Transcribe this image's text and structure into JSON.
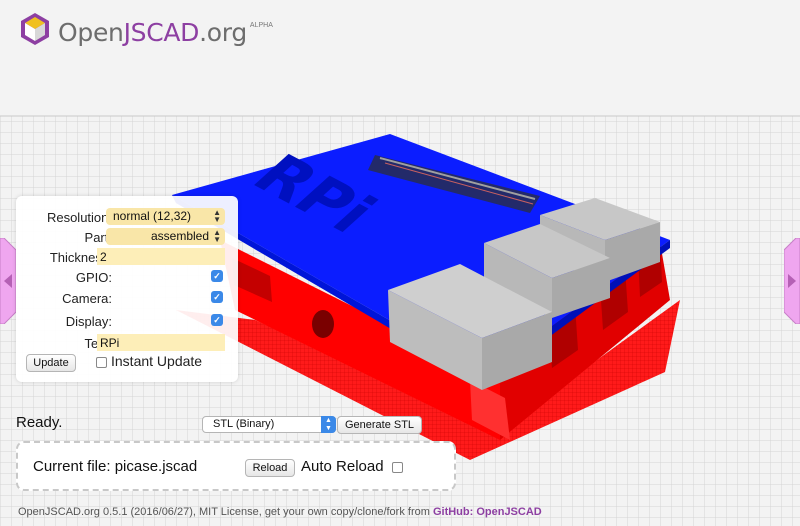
{
  "header": {
    "logo_open": "Open",
    "logo_jscad": "JSCAD",
    "logo_org": ".org",
    "logo_badge": "ALPHA"
  },
  "params": {
    "resolution": {
      "label": "Resolution:",
      "value": "normal (12,32)"
    },
    "part": {
      "label": "Part:",
      "value": "assembled"
    },
    "thickness": {
      "label": "Thickness:",
      "value": "2"
    },
    "gpio": {
      "label": "GPIO:",
      "checked": true
    },
    "camera": {
      "label": "Camera:",
      "checked": true
    },
    "display": {
      "label": "Display:",
      "checked": true
    },
    "text": {
      "label": "Text:",
      "value": "RPi"
    },
    "update_button": "Update",
    "instant_update": {
      "label": "Instant Update",
      "checked": false
    }
  },
  "status": "Ready.",
  "export": {
    "format": "STL (Binary)",
    "generate_button": "Generate STL"
  },
  "file": {
    "current": "Current file: picase.jscad",
    "reload_button": "Reload",
    "auto_reload": {
      "label": "Auto Reload",
      "checked": false
    }
  },
  "footer": {
    "text": "OpenJSCAD.org 0.5.1 (2016/06/27), MIT License, get your own copy/clone/fork from ",
    "link": "GitHub: OpenJSCAD"
  },
  "model_label": "RPi",
  "colors": {
    "case_blue": "#0b1dff",
    "case_red": "#ff0000",
    "accent_purple": "#8d3fa2",
    "tab_pink": "#efa6ef",
    "input_yellow": "#fdeeb8"
  }
}
